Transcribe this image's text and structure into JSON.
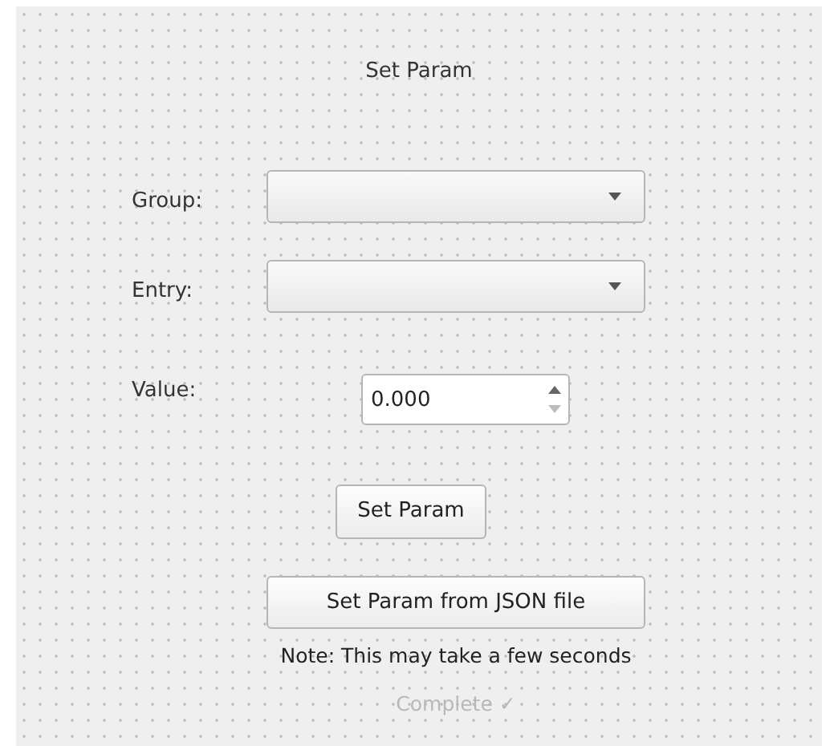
{
  "title": "Set Param",
  "group": {
    "label": "Group:"
  },
  "entry": {
    "label": "Entry:"
  },
  "value": {
    "label": "Value:",
    "value": "0.000"
  },
  "set_button": "Set Param",
  "json_button": "Set Param from JSON file",
  "note": "Note: This may take a few seconds",
  "status": {
    "text": "Complete ✓",
    "disabled": true
  }
}
